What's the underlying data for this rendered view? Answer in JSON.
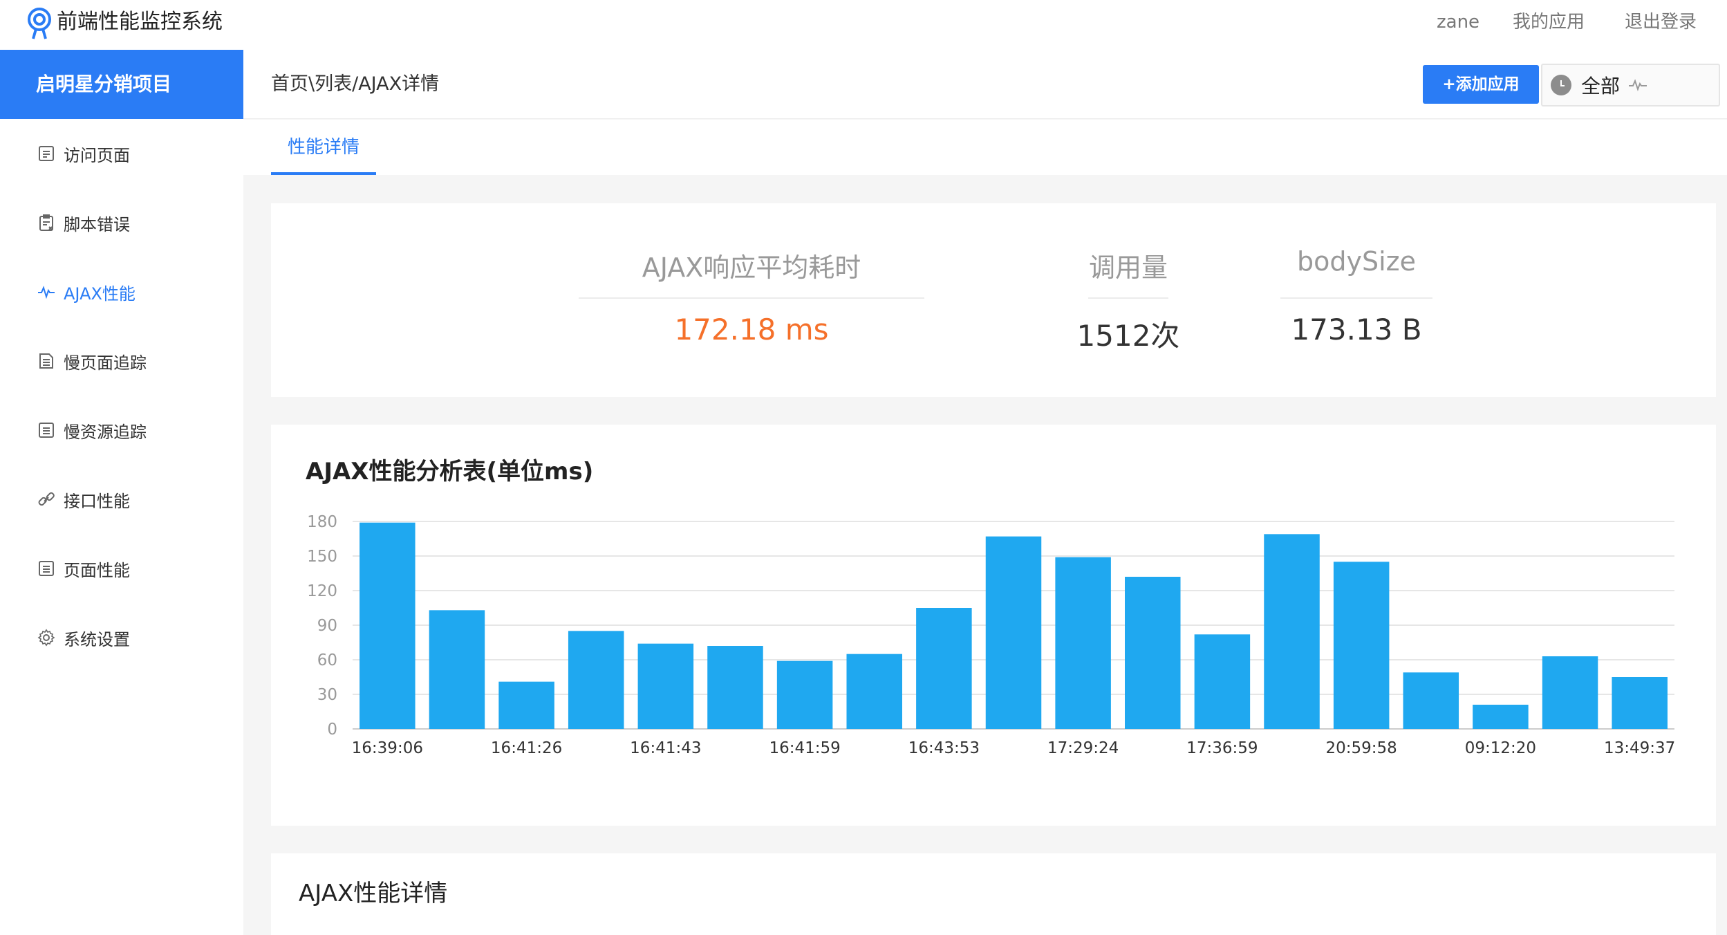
{
  "app": {
    "title": "前端性能监控系统"
  },
  "topnav": {
    "user": "zane",
    "my_apps": "我的应用",
    "logout": "退出登录"
  },
  "sidebar": {
    "project": "启明星分销项目",
    "items": [
      {
        "label": "访问页面",
        "icon": "page-icon"
      },
      {
        "label": "脚本错误",
        "icon": "script-error-icon"
      },
      {
        "label": "AJAX性能",
        "icon": "pulse-icon"
      },
      {
        "label": "慢页面追踪",
        "icon": "slow-page-icon"
      },
      {
        "label": "慢资源追踪",
        "icon": "slow-resource-icon"
      },
      {
        "label": "接口性能",
        "icon": "link-icon"
      },
      {
        "label": "页面性能",
        "icon": "page-perf-icon"
      },
      {
        "label": "系统设置",
        "icon": "gear-icon"
      }
    ]
  },
  "header": {
    "breadcrumb": "首页\\列表/AJAX详情",
    "add_button": "+添加应用",
    "range_label": "全部"
  },
  "tabs": [
    {
      "label": "性能详情"
    }
  ],
  "stats": [
    {
      "label": "AJAX响应平均耗时",
      "value": "172.18 ms"
    },
    {
      "label": "调用量",
      "value": "1512次"
    },
    {
      "label": "bodySize",
      "value": "173.13 B"
    }
  ],
  "colors": {
    "accent": "#2a7cf5",
    "highlight": "#f5702a",
    "bar": "#1fa8f0"
  },
  "chart_data": {
    "type": "bar",
    "title": "AJAX性能分析表(单位ms)",
    "ylim": [
      0,
      180
    ],
    "yticks": [
      0,
      30,
      60,
      90,
      120,
      150,
      180
    ],
    "grid": true,
    "tick_labels": [
      "16:39:06",
      "16:41:26",
      "16:41:43",
      "16:41:59",
      "16:43:53",
      "17:29:24",
      "17:36:59",
      "20:59:58",
      "09:12:20",
      "13:49:37"
    ],
    "values": [
      179,
      103,
      41,
      85,
      74,
      72,
      59,
      65,
      105,
      167,
      149,
      132,
      82,
      169,
      145,
      49,
      21,
      63,
      45
    ]
  },
  "detail": {
    "title": "AJAX性能详情"
  }
}
